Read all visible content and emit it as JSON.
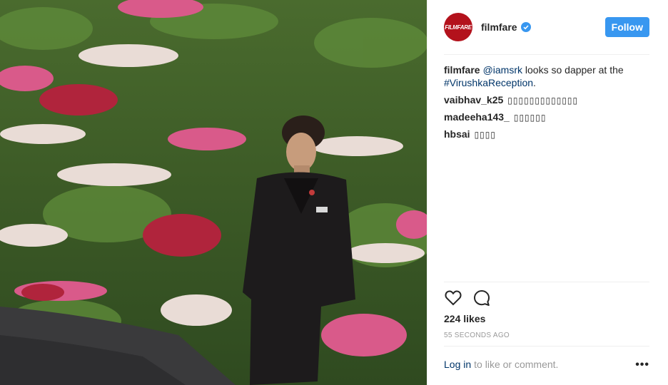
{
  "post": {
    "account": {
      "username": "filmfare",
      "avatar_text": "FILMFARE",
      "verified_icon": "verified-badge-icon",
      "follow_label": "Follow"
    },
    "caption": {
      "username": "filmfare",
      "mention": "@iamsrk",
      "text": "looks so dapper at the",
      "hashtag": "#VirushkaReception",
      "end": "."
    },
    "comments": [
      {
        "username": "vaibhav_k25",
        "text": "▯▯▯▯▯▯▯▯▯▯▯▯▯"
      },
      {
        "username": "madeeha143_",
        "text": "▯▯▯▯▯▯"
      },
      {
        "username": "hbsai",
        "text": "▯▯▯▯"
      }
    ],
    "actions": {
      "like_icon": "heart-icon",
      "comment_icon": "comment-icon"
    },
    "likes": "224 likes",
    "timestamp": "55 SECONDS AGO",
    "login": {
      "link": "Log in",
      "text": "to like or comment.",
      "more": "•••"
    }
  },
  "colors": {
    "accent": "#3897f0",
    "brand_avatar": "#b3121c",
    "link": "#003569",
    "muted": "#999999"
  }
}
